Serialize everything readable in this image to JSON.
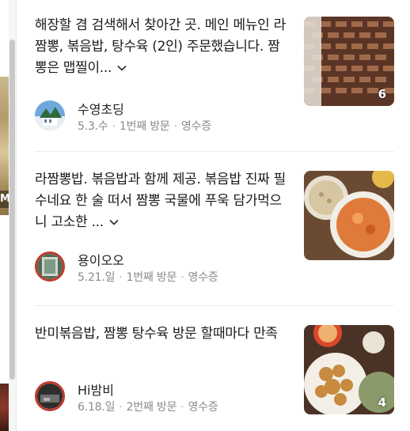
{
  "left_panel": {
    "photo_label": "M"
  },
  "reviews": [
    {
      "text": "해장할 겸 검색해서 찾아간 곳. 메인 메뉴인 라 짬뽕, 볶음밥, 탕수육 (2인) 주문했습니다. 짬뽕은 맵찔이...",
      "author": "수영초딩",
      "date": "5.3.수",
      "visit": "1번째 방문",
      "verify": "영수증",
      "photo_count": "6"
    },
    {
      "text": "라짬뽕밥. 볶음밥과 함께 제공. 볶음밥 진짜 필수네요 한 술 떠서 짬뽕 국물에 푸욱 담가먹으니 고소한 ...",
      "author": "용이오오",
      "date": "5.21.일",
      "visit": "1번째 방문",
      "verify": "영수증",
      "photo_count": ""
    },
    {
      "text": "반미볶음밥, 짬뽕 탕수육 방문 할때마다 만족",
      "author": "Hi밤비",
      "date": "6.18.일",
      "visit": "2번째 방문",
      "verify": "영수증",
      "photo_count": "4"
    }
  ],
  "icons": {
    "expand": "chevron-down-icon"
  }
}
